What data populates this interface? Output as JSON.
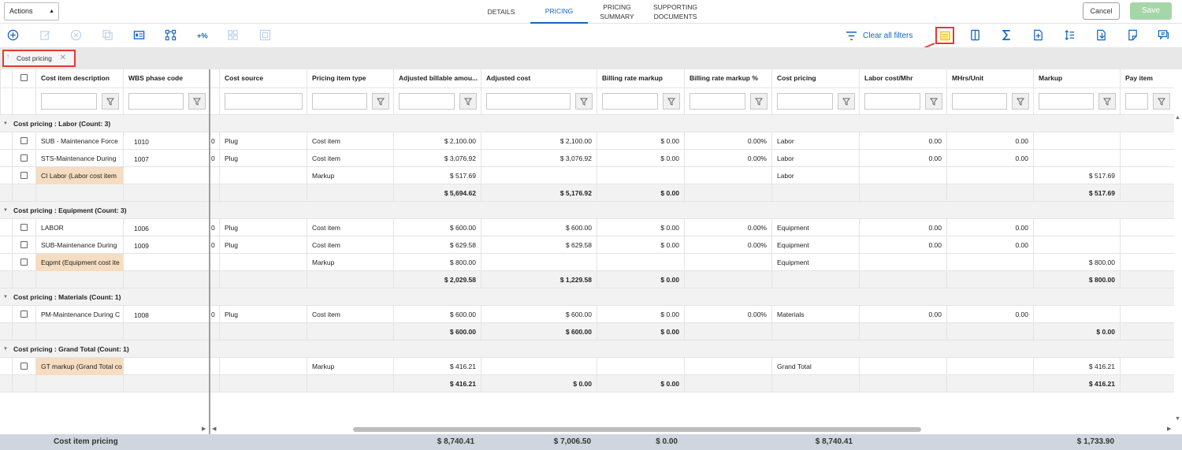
{
  "header": {
    "actions_label": "Actions",
    "tabs": [
      {
        "label": "DETAILS",
        "active": false
      },
      {
        "label": "PRICING",
        "active": true
      },
      {
        "label": "PRICING SUMMARY",
        "active": false
      },
      {
        "label": "SUPPORTING DOCUMENTS",
        "active": false
      }
    ],
    "cancel_label": "Cancel",
    "save_label": "Save"
  },
  "toolbar": {
    "clear_filters_label": "Clear all filters",
    "left_icons": [
      "add-icon",
      "edit-icon",
      "delete-icon",
      "copy-icon",
      "card-view-icon",
      "hierarchy-icon",
      "percent-icon",
      "grid-icon",
      "fit-icon"
    ],
    "right_icons": [
      "group-panel-icon",
      "columns-icon",
      "sum-icon",
      "add-row-icon",
      "sort-icon",
      "export-icon",
      "edit-doc-icon",
      "chat-icon"
    ]
  },
  "group_panel": {
    "chip_label": "Cost pricing"
  },
  "columns": [
    "",
    "Cost item description",
    "WBS phase code",
    "",
    "Cost source",
    "Pricing item type",
    "Adjusted billable amou...",
    "Adjusted cost",
    "Billing rate markup",
    "Billing rate markup %",
    "Cost pricing",
    "Labor cost/Mhr",
    "MHrs/Unit",
    "Markup",
    "Pay item"
  ],
  "groups": [
    {
      "label": "Cost pricing : Labor (Count: 3)",
      "rows": [
        {
          "desc": "SUB - Maintenance Force",
          "wbs": "1010",
          "zero": "0",
          "source": "Plug",
          "type": "Cost item",
          "billable": "$ 2,100.00",
          "cost": "$ 2,100.00",
          "brm": "$ 0.00",
          "brmp": "0.00%",
          "pricing": "Labor",
          "labor": "0.00",
          "mhrs": "0.00",
          "markup": "",
          "peach": false
        },
        {
          "desc": "STS-Maintenance During",
          "wbs": "1007",
          "zero": "0",
          "source": "Plug",
          "type": "Cost item",
          "billable": "$ 3,076.92",
          "cost": "$ 3,076.92",
          "brm": "$ 0.00",
          "brmp": "0.00%",
          "pricing": "Labor",
          "labor": "0.00",
          "mhrs": "0.00",
          "markup": "",
          "peach": false
        },
        {
          "desc": "CI Labor (Labor cost item",
          "wbs": "",
          "zero": "",
          "source": "",
          "type": "Markup",
          "billable": "$ 517.69",
          "cost": "",
          "brm": "",
          "brmp": "",
          "pricing": "Labor",
          "labor": "",
          "mhrs": "",
          "markup": "$ 517.69",
          "peach": true
        }
      ],
      "subtotal": {
        "billable": "$ 5,694.62",
        "cost": "$ 5,176.92",
        "brm": "$ 0.00",
        "markup": "$ 517.69"
      }
    },
    {
      "label": "Cost pricing : Equipment (Count: 3)",
      "rows": [
        {
          "desc": "LABOR",
          "wbs": "1006",
          "zero": "0",
          "source": "Plug",
          "type": "Cost item",
          "billable": "$ 600.00",
          "cost": "$ 600.00",
          "brm": "$ 0.00",
          "brmp": "0.00%",
          "pricing": "Equipment",
          "labor": "0.00",
          "mhrs": "0.00",
          "markup": "",
          "peach": false
        },
        {
          "desc": "SUB-Maintenance During",
          "wbs": "1009",
          "zero": "0",
          "source": "Plug",
          "type": "Cost item",
          "billable": "$ 629.58",
          "cost": "$ 629.58",
          "brm": "$ 0.00",
          "brmp": "0.00%",
          "pricing": "Equipment",
          "labor": "0.00",
          "mhrs": "0.00",
          "markup": "",
          "peach": false
        },
        {
          "desc": "Eqpmt (Equipment cost ite",
          "wbs": "",
          "zero": "",
          "source": "",
          "type": "Markup",
          "billable": "$ 800.00",
          "cost": "",
          "brm": "",
          "brmp": "",
          "pricing": "Equipment",
          "labor": "",
          "mhrs": "",
          "markup": "$ 800.00",
          "peach": true
        }
      ],
      "subtotal": {
        "billable": "$ 2,029.58",
        "cost": "$ 1,229.58",
        "brm": "$ 0.00",
        "markup": "$ 800.00"
      }
    },
    {
      "label": "Cost pricing : Materials (Count: 1)",
      "rows": [
        {
          "desc": "PM-Maintenance During C",
          "wbs": "1008",
          "zero": "0",
          "source": "Plug",
          "type": "Cost item",
          "billable": "$ 600.00",
          "cost": "$ 600.00",
          "brm": "$ 0.00",
          "brmp": "0.00%",
          "pricing": "Materials",
          "labor": "0.00",
          "mhrs": "0.00",
          "markup": "",
          "peach": false
        }
      ],
      "subtotal": {
        "billable": "$ 600.00",
        "cost": "$ 600.00",
        "brm": "$ 0.00",
        "markup": "$ 0.00"
      }
    },
    {
      "label": "Cost pricing : Grand Total (Count: 1)",
      "rows": [
        {
          "desc": "GT markup (Grand Total co",
          "wbs": "",
          "zero": "",
          "source": "",
          "type": "Markup",
          "billable": "$ 416.21",
          "cost": "",
          "brm": "",
          "brmp": "",
          "pricing": "Grand Total",
          "labor": "",
          "mhrs": "",
          "markup": "$ 416.21",
          "peach": true
        }
      ],
      "subtotal": {
        "billable": "$ 416.21",
        "cost": "$ 0.00",
        "brm": "$ 0.00",
        "markup": "$ 416.21"
      }
    }
  ],
  "footer": {
    "label": "Cost item pricing",
    "billable": "$ 8,740.41",
    "cost": "$ 7,006.50",
    "brm": "$ 0.00",
    "pricing": "$ 8,740.41",
    "markup": "$ 1,733.90"
  },
  "colors": {
    "accent": "#1565c0",
    "save": "#a5d6a7",
    "highlight": "#e53935",
    "peach": "#f6dcc0"
  }
}
